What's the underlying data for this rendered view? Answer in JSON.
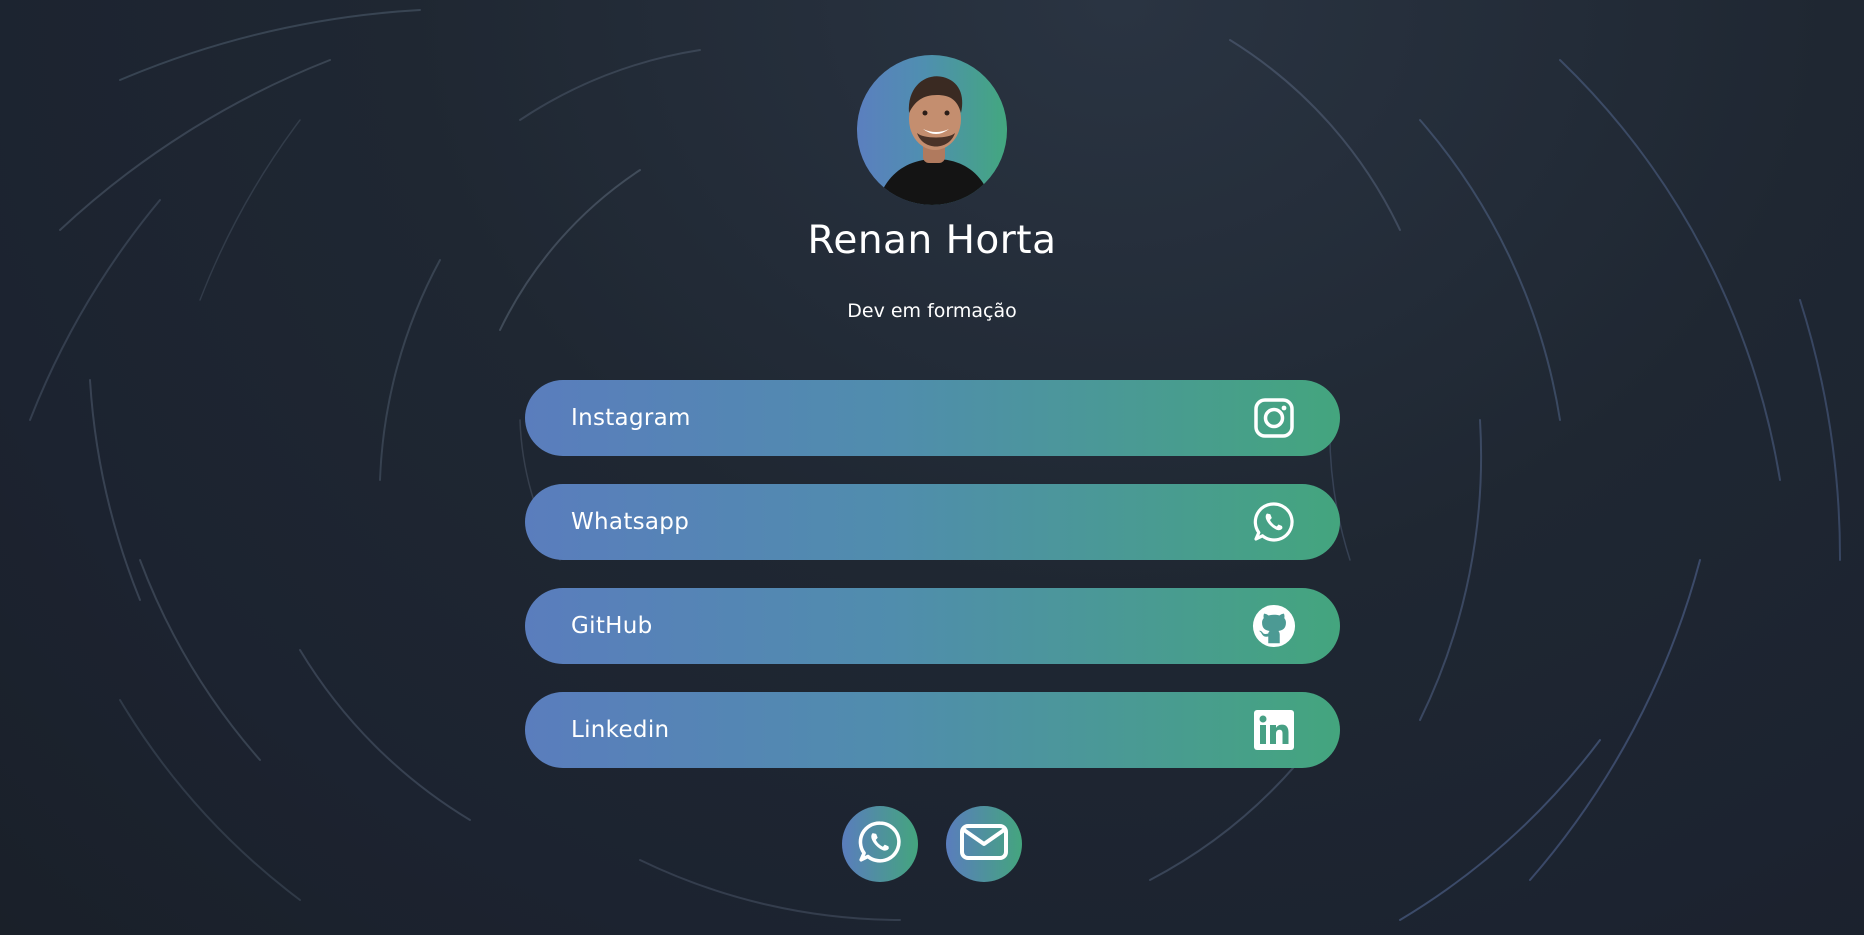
{
  "profile": {
    "name": "Renan Horta",
    "subtitle": "Dev em formação",
    "avatar_alt": "profile-photo"
  },
  "links": [
    {
      "label": "Instagram",
      "icon": "instagram-icon"
    },
    {
      "label": "Whatsapp",
      "icon": "whatsapp-icon"
    },
    {
      "label": "GitHub",
      "icon": "github-icon"
    },
    {
      "label": "Linkedin",
      "icon": "linkedin-icon"
    }
  ],
  "footer_buttons": [
    {
      "icon": "whatsapp-icon"
    },
    {
      "icon": "mail-icon"
    }
  ],
  "colors": {
    "background": "#1f2732",
    "gradient_start": "#5a7dbd",
    "gradient_end": "#44a57e",
    "text": "#ffffff"
  }
}
